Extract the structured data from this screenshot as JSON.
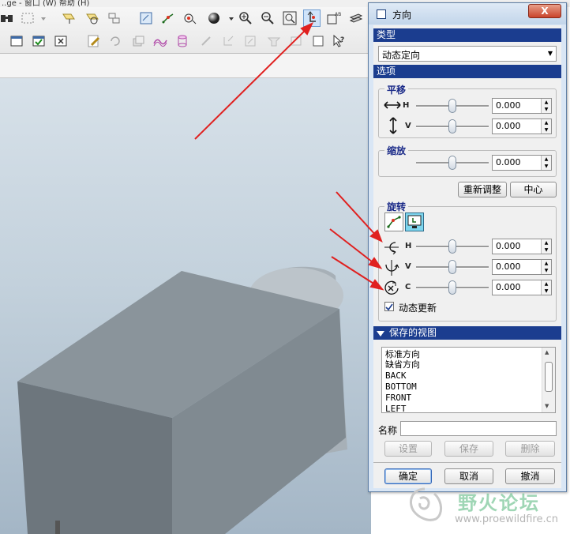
{
  "menubar": {
    "text": "..ge - 窗口 (W)  帮助 (H)"
  },
  "toolbar": {
    "row1_icons": [
      "binoculars-icon",
      "select-box-icon",
      "dropdown-arrow-icon",
      "datum-plane-icon",
      "datum-plane-alt-icon",
      "layers-icon",
      "repaint-icon",
      "datum-point-icon",
      "spin-center-icon",
      "shading-sphere-icon",
      "dropdown-arrow-icon",
      "zoom-in-icon",
      "zoom-out-icon",
      "zoom-fit-icon",
      "orient-mode-icon",
      "named-views-icon",
      "layer-stack-icon"
    ],
    "row2_icons": [
      "window-icon",
      "checkbox-window-icon",
      "close-window-icon",
      "edit-pencil-icon",
      "undo-icon",
      "sketch-icon",
      "surface-icon",
      "cylinder-icon",
      "datum-axis-icon",
      "datum-csys-icon",
      "datum-curve-icon",
      "feature-icon",
      "region-icon",
      "whats-this-icon"
    ]
  },
  "dialog": {
    "title": "方向",
    "close_label": "X",
    "type_header": "类型",
    "type_value": "动态定向",
    "options_header": "选项",
    "pan": {
      "label": "平移",
      "h_label": "H",
      "v_label": "V",
      "h_value": "0.000",
      "v_value": "0.000",
      "h_pos": 0.5,
      "v_pos": 0.5
    },
    "zoom": {
      "label": "缩放",
      "value": "0.000",
      "pos": 0.5
    },
    "readjust_button": "重新调整",
    "center_button": "中心",
    "rotate": {
      "label": "旋转",
      "h_label": "H",
      "v_label": "V",
      "c_label": "C",
      "h_value": "0.000",
      "v_value": "0.000",
      "c_value": "0.000",
      "h_pos": 0.5,
      "v_pos": 0.5,
      "c_pos": 0.5
    },
    "dynamic_update_label": "动态更新",
    "dynamic_update_checked": true,
    "saved_views_header": "保存的视图",
    "saved_views": [
      "标准方向",
      "缺省方向",
      "BACK",
      "BOTTOM",
      "FRONT",
      "LEFT"
    ],
    "name_label": "名称",
    "name_value": "",
    "set_button": "设置",
    "save_button": "保存",
    "delete_button": "删除",
    "ok_button": "确定",
    "cancel_button": "取消",
    "revert_button": "撤消"
  },
  "watermark": {
    "title": "野火论坛",
    "url": "www.proewildfire.cn"
  },
  "colors": {
    "section_header": "#1b3d8f",
    "group_label": "#1a2a88",
    "annotation_arrow": "#e0201f",
    "model_gray": "#8e979e"
  }
}
